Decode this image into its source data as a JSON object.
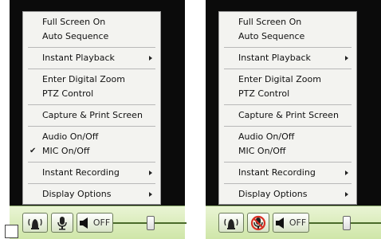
{
  "left_panel": {
    "menu": [
      {
        "label": "Full Screen On",
        "checked": false,
        "submenu": false
      },
      {
        "label": "Auto Sequence",
        "checked": false,
        "submenu": false
      },
      {
        "separator": true
      },
      {
        "label": "Instant Playback",
        "checked": false,
        "submenu": true
      },
      {
        "separator": true
      },
      {
        "label": "Enter Digital Zoom",
        "checked": false,
        "submenu": false
      },
      {
        "label": "PTZ Control",
        "checked": false,
        "submenu": false
      },
      {
        "separator": true
      },
      {
        "label": "Capture & Print Screen",
        "checked": false,
        "submenu": false
      },
      {
        "separator": true
      },
      {
        "label": "Audio On/Off",
        "checked": false,
        "submenu": false
      },
      {
        "label": "MIC On/Off",
        "checked": true,
        "submenu": false
      },
      {
        "separator": true
      },
      {
        "label": "Instant Recording",
        "checked": false,
        "submenu": true
      },
      {
        "separator": true
      },
      {
        "label": "Display Options",
        "checked": false,
        "submenu": true
      }
    ],
    "toolbar": {
      "mic_state": "on",
      "speaker_label": "OFF"
    }
  },
  "right_panel": {
    "menu": [
      {
        "label": "Full Screen On",
        "checked": false,
        "submenu": false
      },
      {
        "label": "Auto Sequence",
        "checked": false,
        "submenu": false
      },
      {
        "separator": true
      },
      {
        "label": "Instant Playback",
        "checked": false,
        "submenu": true
      },
      {
        "separator": true
      },
      {
        "label": "Enter Digital Zoom",
        "checked": false,
        "submenu": false
      },
      {
        "label": "PTZ Control",
        "checked": false,
        "submenu": false
      },
      {
        "separator": true
      },
      {
        "label": "Capture & Print Screen",
        "checked": false,
        "submenu": false
      },
      {
        "separator": true
      },
      {
        "label": "Audio On/Off",
        "checked": false,
        "submenu": false
      },
      {
        "label": "MIC On/Off",
        "checked": false,
        "submenu": false
      },
      {
        "separator": true
      },
      {
        "label": "Instant Recording",
        "checked": false,
        "submenu": true
      },
      {
        "separator": true
      },
      {
        "label": "Display Options",
        "checked": false,
        "submenu": true
      }
    ],
    "toolbar": {
      "mic_state": "muted",
      "speaker_label": "OFF"
    }
  },
  "colors": {
    "menu_bg": "#f3f3f0",
    "video_bg": "#0b0b0b",
    "toolbar_bg": "#d9ecb8",
    "mute_red": "#d93025"
  },
  "icons": {
    "audio": "alarm-speaker-icon",
    "mic_on": "microphone-icon",
    "mic_muted": "microphone-muted-icon",
    "speaker": "speaker-icon",
    "slider": "volume-slider"
  },
  "volume_level": 0.5
}
